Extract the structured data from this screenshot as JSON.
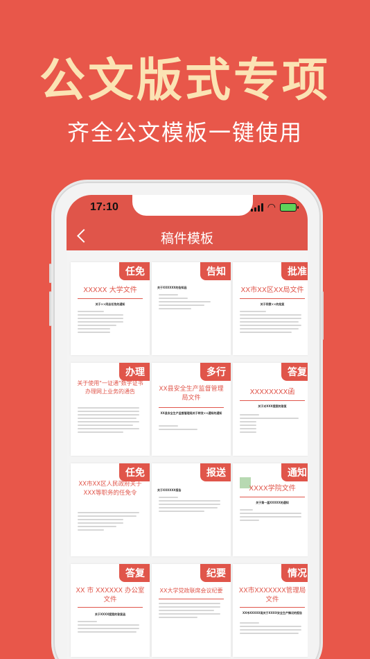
{
  "hero": {
    "title": "公文版式专项",
    "subtitle": "齐全公文模板一键使用"
  },
  "status_bar": {
    "time": "17:10"
  },
  "nav": {
    "title": "稿件模板"
  },
  "cards": [
    {
      "tag": "任免",
      "heading": "XXXXX 大学文件",
      "sub": "关于××同志任免的通知"
    },
    {
      "tag": "告知",
      "heading": "",
      "sub": "关于XXXXXX的告知函"
    },
    {
      "tag": "批准",
      "heading": "XX市XX区XX局文件",
      "sub": "关于同意××的批复"
    },
    {
      "tag": "办理",
      "heading": "关于使用\"一证通\"数字证书办理网上业务的通告",
      "sub": ""
    },
    {
      "tag": "多行",
      "heading": "XX县安全生产监督管理局文件",
      "sub": "XX县安全生产监督管理局关于转发××通知的通知"
    },
    {
      "tag": "答复",
      "heading": "XXXXXXXX函",
      "sub": "关于对XXX提案的答复"
    },
    {
      "tag": "任免",
      "heading": "XX市XX区人民政府关于XXX等职务的任免令",
      "sub": ""
    },
    {
      "tag": "报送",
      "heading": "",
      "sub": "关于XXXXXX报告"
    },
    {
      "tag": "通知",
      "heading": "XXXX学院文件",
      "sub": "关于第一届XXXXX的通知"
    },
    {
      "tag": "答复",
      "heading": "XX 市 XXXXXX 办公室文件",
      "sub": "关于XXXX提案的答复函"
    },
    {
      "tag": "纪要",
      "heading": "XX大学党政联席会议纪要",
      "sub": ""
    },
    {
      "tag": "情况",
      "heading": "XX市XXXXXXX管理局文件",
      "sub": "XX市XXXXX局关于XXXX安全生产情况的报告"
    }
  ]
}
